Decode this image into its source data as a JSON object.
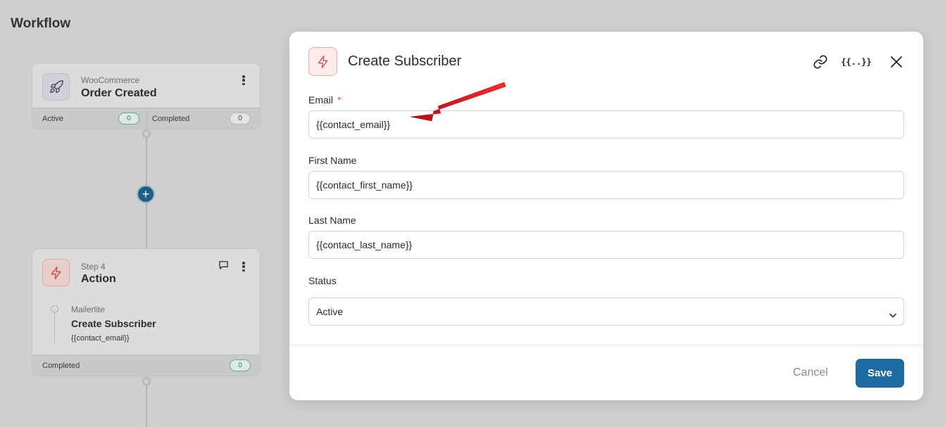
{
  "page": {
    "title": "Workflow"
  },
  "trigger_node": {
    "app": "WooCommerce",
    "title": "Order Created",
    "active_label": "Active",
    "active_count": "0",
    "completed_label": "Completed",
    "completed_count": "0"
  },
  "action_node": {
    "step": "Step 4",
    "title": "Action",
    "sub_app": "Mailerlite",
    "sub_title": "Create Subscriber",
    "sub_value": "{{contact_email}}",
    "completed_label": "Completed",
    "completed_count": "0"
  },
  "modal": {
    "title": "Create Subscriber",
    "variables_button": "{{..}}",
    "fields": {
      "email": {
        "label": "Email",
        "required_mark": "*",
        "value": "{{contact_email}}"
      },
      "first_name": {
        "label": "First Name",
        "value": "{{contact_first_name}}"
      },
      "last_name": {
        "label": "Last Name",
        "value": "{{contact_last_name}}"
      },
      "status": {
        "label": "Status",
        "value": "Active"
      }
    },
    "cancel_label": "Cancel",
    "save_label": "Save"
  },
  "colors": {
    "accent": "#1f6aa1",
    "action_icon": "#d9534f",
    "annotation_arrow": "#e8161b"
  },
  "icons": [
    "rocket-icon",
    "lightning-icon",
    "kebab-menu-icon",
    "comment-icon",
    "plus-icon",
    "link-icon",
    "variables-icon",
    "close-icon",
    "chevron-down-icon"
  ]
}
